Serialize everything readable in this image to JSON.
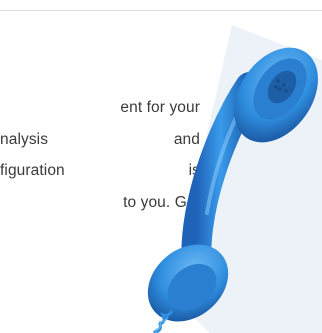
{
  "content": {
    "lines": [
      "ent for your",
      "nalysis and",
      "figuration is",
      "to you. Get"
    ]
  },
  "colors": {
    "text": "#3a3a3a",
    "divider": "#dcdcdc",
    "handset_blue": "#2f8fe0",
    "handset_dark": "#1f63b8",
    "backdrop": "#dde8f2"
  },
  "icons": {
    "phone": "telephone-handset-icon"
  }
}
